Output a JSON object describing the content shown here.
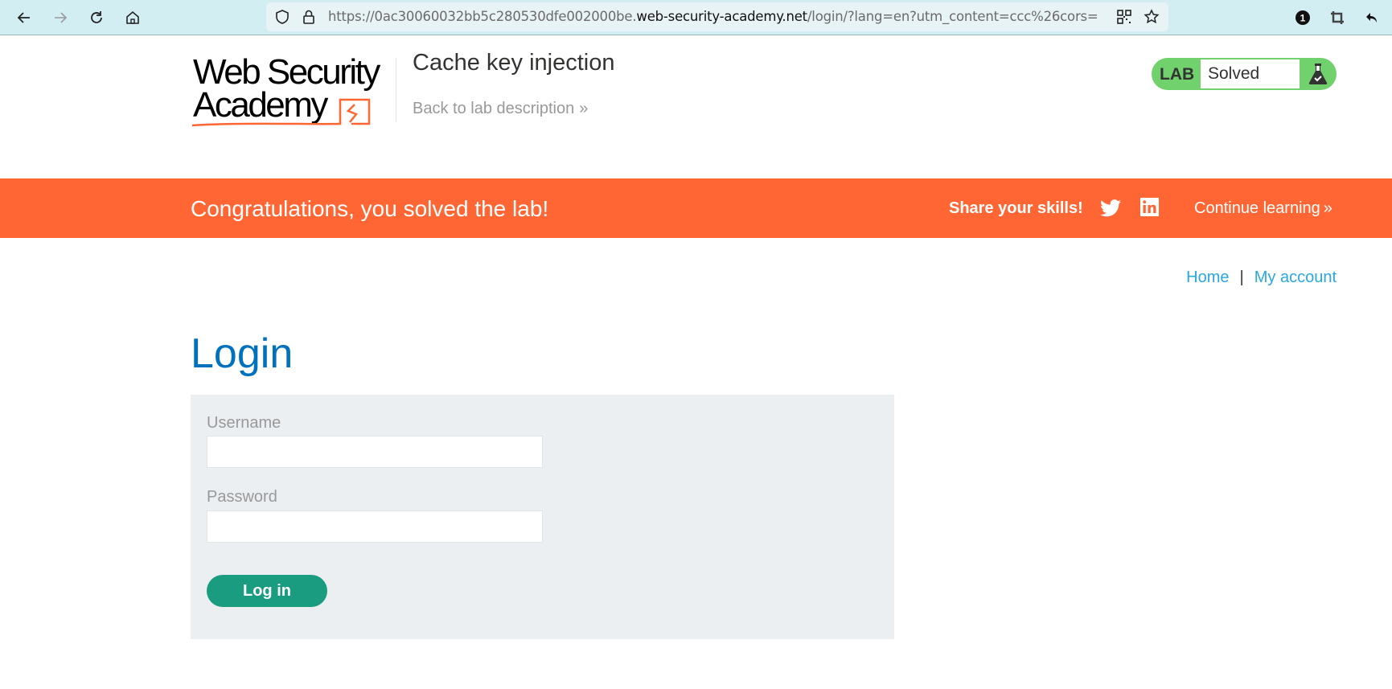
{
  "browser": {
    "url_prefix": "https://0ac30060032bb5c280530dfe002000be.",
    "url_domain": "web-security-academy.net",
    "url_suffix": "/login/?lang=en?utm_content=ccc%26cors=",
    "notification_count": "1"
  },
  "header": {
    "logo_line1": "Web Security",
    "logo_line2": "Academy",
    "lab_title": "Cache key injection",
    "back_link": "Back to lab description",
    "back_chevron": "»",
    "lab_badge": {
      "label": "LAB",
      "status": "Solved",
      "color": "#70d16d"
    }
  },
  "banner": {
    "message": "Congratulations, you solved the lab!",
    "share_label": "Share your skills!",
    "continue_label": "Continue learning",
    "continue_chevron": "»",
    "color": "#ff6633"
  },
  "nav": {
    "home": "Home",
    "separator": "|",
    "my_account": "My account"
  },
  "login": {
    "heading": "Login",
    "username_label": "Username",
    "username_value": "",
    "password_label": "Password",
    "password_value": "",
    "submit_label": "Log in",
    "button_color": "#1a9c80"
  }
}
